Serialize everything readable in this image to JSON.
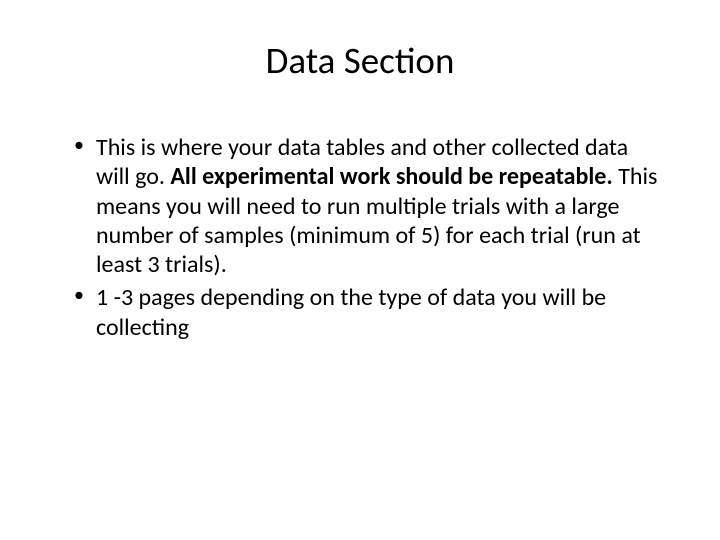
{
  "slide": {
    "title": "Data Section",
    "bullets": [
      {
        "pre": " This is where your data tables and other collected data will go. ",
        "bold": "All experimental work should be repeatable.",
        "post": " This means you will need to run multiple trials with a large number of samples (minimum of 5) for each trial (run at least 3 trials)."
      },
      {
        "pre": "1 -3 pages depending on the type of data you will be collecting",
        "bold": "",
        "post": ""
      }
    ]
  }
}
